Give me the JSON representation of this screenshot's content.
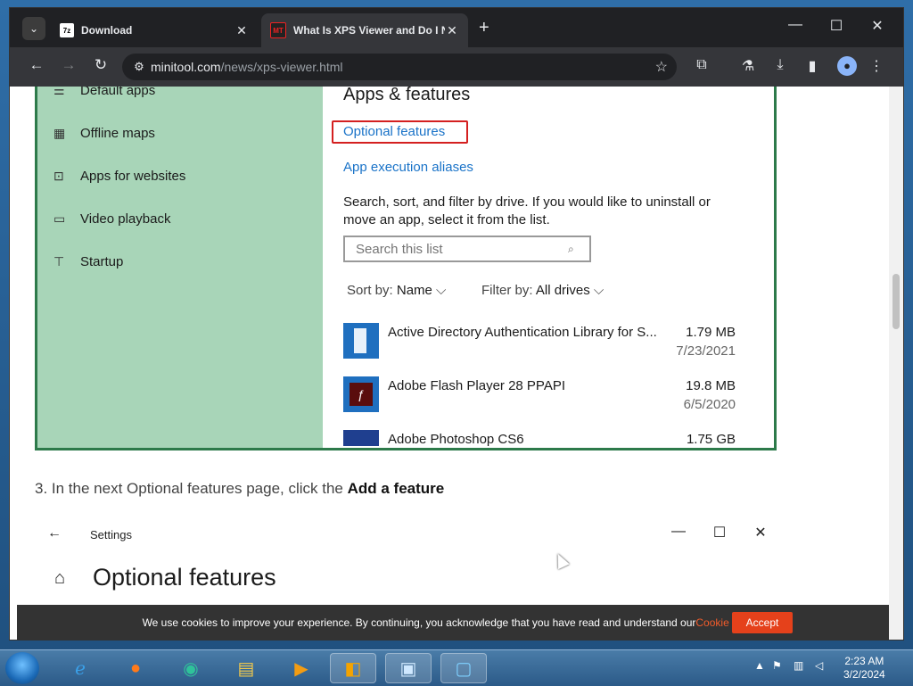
{
  "browser": {
    "tabs": [
      {
        "label": "Download",
        "favicon": "7z-icon"
      },
      {
        "label": "What Is XPS Viewer and Do I Need It",
        "favicon": "MT"
      }
    ],
    "url_domain": "minitool.com",
    "url_path": "/news/xps-viewer.html"
  },
  "article": {
    "settings_sidebar": [
      "Default apps",
      "Offline maps",
      "Apps for websites",
      "Video playback",
      "Startup"
    ],
    "pane_title": "Apps & features",
    "link_optional": "Optional features",
    "link_aliases": "App execution aliases",
    "description": "Search, sort, and filter by drive. If you would like to uninstall or move an app, select it from the list.",
    "search_placeholder": "Search this list",
    "sort_label": "Sort by:",
    "sort_value": "Name",
    "filter_label": "Filter by:",
    "filter_value": "All drives",
    "apps": [
      {
        "name": "Active Directory Authentication Library for S...",
        "size": "1.79 MB",
        "date": "7/23/2021"
      },
      {
        "name": "Adobe Flash Player 28 PPAPI",
        "size": "19.8 MB",
        "date": "6/5/2020"
      },
      {
        "name": "Adobe Photoshop CS6",
        "size": "1.75 GB",
        "date": ""
      }
    ],
    "step_text": "3. In the next Optional features page, click the ",
    "step_bold": "Add a feature",
    "settings2_title": "Settings",
    "settings2_heading": "Optional features"
  },
  "cookie": {
    "text": "We use cookies to improve your experience. By continuing, you acknowledge that you have read and understand our ",
    "policy": "Cookie Policy",
    "period": ".",
    "accept": "Accept"
  },
  "taskbar": {
    "time": "2:23 AM",
    "date": "3/2/2024"
  },
  "colors": {
    "accent_link": "#1a73c8",
    "settings_sidebar": "#a8d5b8",
    "highlight_box": "#d42020",
    "cookie_button": "#e5411b"
  }
}
